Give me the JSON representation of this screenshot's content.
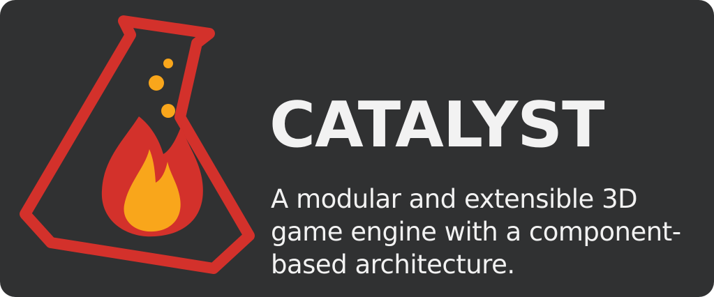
{
  "brand": {
    "title": "CATALYST",
    "tagline_lines": [
      "A modular and extensible 3D",
      "game engine with a component-",
      "based architecture."
    ]
  },
  "logo": {
    "icon": "flask-flame-icon"
  },
  "colors": {
    "background": "#303132",
    "flask_outline": "#d3312b",
    "flame_outer": "#d3312b",
    "flame_inner": "#f9a61b",
    "bubbles": "#f9a61b",
    "text": "#f2f2f2"
  }
}
